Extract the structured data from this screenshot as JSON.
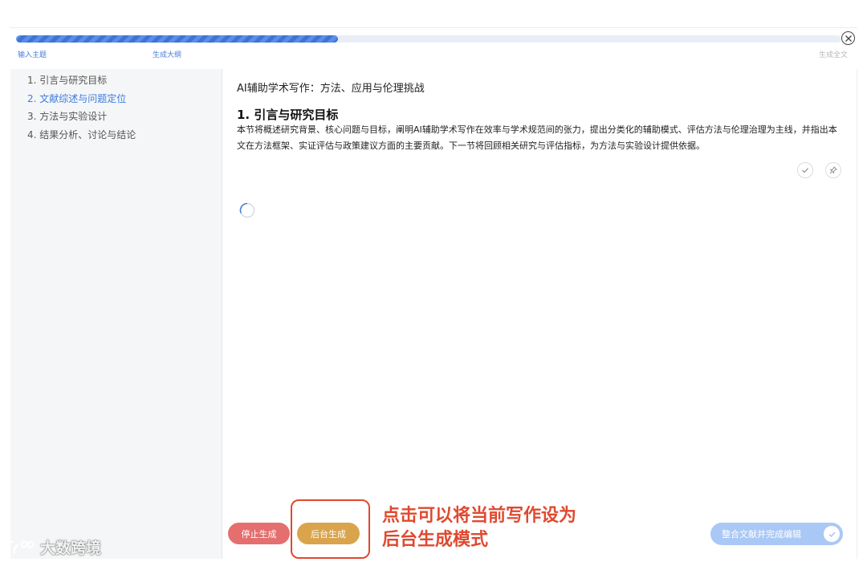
{
  "progress": {
    "percent": 39,
    "steps": [
      {
        "label": "输入主题",
        "state": "done"
      },
      {
        "label": "生成大纲",
        "state": "done"
      },
      {
        "label": "生成全文",
        "state": "pending"
      }
    ]
  },
  "outline": {
    "items": [
      {
        "label": "1. 引言与研究目标"
      },
      {
        "label": "2. 文献综述与问题定位",
        "active": true
      },
      {
        "label": "3. 方法与实验设计"
      },
      {
        "label": "4. 结果分析、讨论与结论"
      }
    ]
  },
  "document": {
    "title": "AI辅助学术写作：方法、应用与伦理挑战",
    "section_heading": "1. 引言与研究目标",
    "section_body": "本节将概述研究背景、核心问题与目标，阐明AI辅助学术写作在效率与学术规范间的张力，提出分类化的辅助模式、评估方法与伦理治理为主线，并指出本文在方法框架、实证评估与政策建议方面的主要贡献。下一节将回顾相关研究与评估指标，为方法与实验设计提供依据。"
  },
  "icons": {
    "close": "close-circle-icon",
    "confirm": "check-icon",
    "pin": "pin-icon",
    "loading": "spinner-icon"
  },
  "actions": {
    "stop_label": "停止生成",
    "background_label": "后台生成",
    "finish_label": "整合文献并完成编辑"
  },
  "annotation": {
    "text": "点击可以将当前写作设为后台生成模式"
  },
  "watermark": {
    "text": "大数跨境"
  },
  "colors": {
    "accent": "#3d7be0",
    "stop": "#e56e6e",
    "background_btn": "#d9a44b",
    "annotation": "#e0492f",
    "finish_btn": "#aac8f5"
  }
}
